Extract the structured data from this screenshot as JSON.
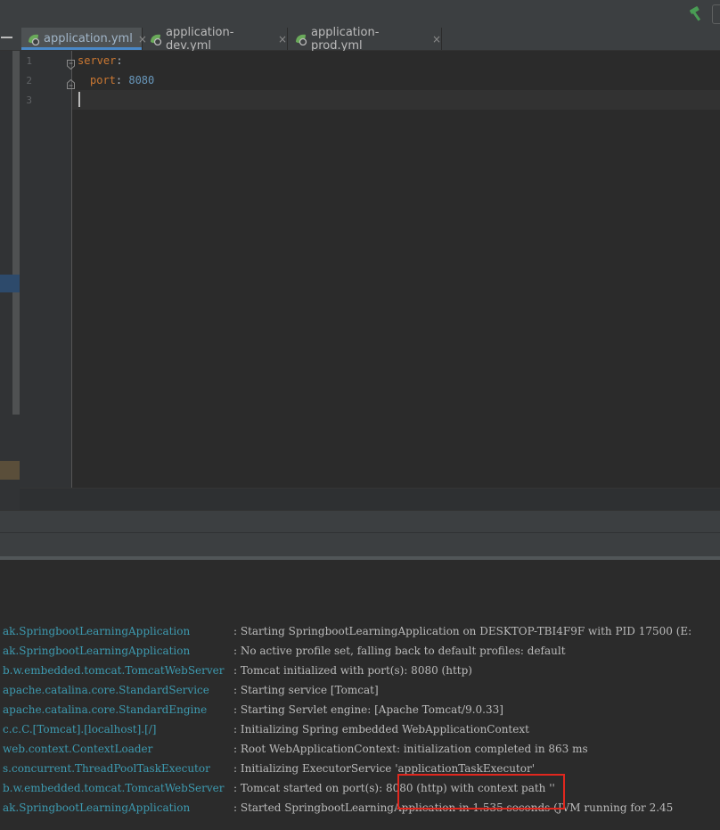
{
  "toolbar": {
    "build_icon": "hammer-icon"
  },
  "tabs": [
    {
      "label": "application.yml",
      "icon": "spring-yaml-file-icon",
      "active": true
    },
    {
      "label": "application-dev.yml",
      "icon": "spring-yaml-file-icon",
      "active": false
    },
    {
      "label": "application-prod.yml",
      "icon": "spring-yaml-file-icon",
      "active": false
    }
  ],
  "tab_close_glyph": "×",
  "editor": {
    "line_numbers": [
      "1",
      "2",
      "3"
    ],
    "lines": [
      {
        "key": "server",
        "sep": ":",
        "value": ""
      },
      {
        "key": "port",
        "sep": ": ",
        "value": "8080"
      },
      {
        "key": "",
        "sep": "",
        "value": ""
      }
    ]
  },
  "console": {
    "rows": [
      {
        "source": "ak.SpringbootLearningApplication",
        "message": ": Starting SpringbootLearningApplication on DESKTOP-TBI4F9F with PID 17500 (E:"
      },
      {
        "source": "ak.SpringbootLearningApplication",
        "message": ": No active profile set, falling back to default profiles: default"
      },
      {
        "source": "b.w.embedded.tomcat.TomcatWebServer",
        "message": ": Tomcat initialized with port(s): 8080 (http)"
      },
      {
        "source": "apache.catalina.core.StandardService",
        "message": ": Starting service [Tomcat]"
      },
      {
        "source": "apache.catalina.core.StandardEngine",
        "message": ": Starting Servlet engine: [Apache Tomcat/9.0.33]"
      },
      {
        "source": "c.c.C.[Tomcat].[localhost].[/]",
        "message": ": Initializing Spring embedded WebApplicationContext"
      },
      {
        "source": "web.context.ContextLoader",
        "message": ": Root WebApplicationContext: initialization completed in 863 ms"
      },
      {
        "source": "s.concurrent.ThreadPoolTaskExecutor",
        "message": ": Initializing ExecutorService 'applicationTaskExecutor'"
      },
      {
        "source": "b.w.embedded.tomcat.TomcatWebServer",
        "message": ": Tomcat started on port(s): 8080 (http) with context path ''"
      },
      {
        "source": "ak.SpringbootLearningApplication",
        "message": ": Started SpringbootLearningApplication in 1.535 seconds (JVM running for 2.45"
      }
    ]
  },
  "colors": {
    "highlight_box": "#e0271e",
    "log_source": "#3d9ab0",
    "yaml_key": "#cc7832",
    "yaml_number": "#6897bb"
  }
}
